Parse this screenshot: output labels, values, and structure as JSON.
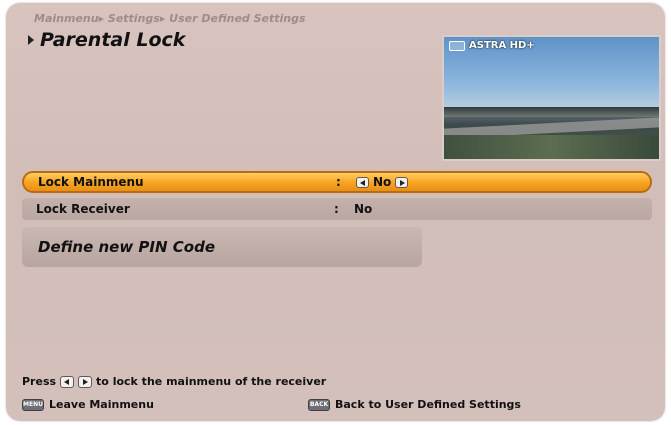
{
  "header": {
    "breadcrumb": "Mainmenu▸ Settings▸ User Defined Settings",
    "title": "Parental Lock"
  },
  "preview": {
    "channel": "ASTRA HD+",
    "channel_icon": "hd-icon"
  },
  "settings": [
    {
      "label": "Lock Mainmenu",
      "colon": ":",
      "value": "No",
      "selected": true
    },
    {
      "label": "Lock Receiver",
      "colon": ":",
      "value": "No",
      "selected": false
    }
  ],
  "pin_button": {
    "label": "Define new PIN Code"
  },
  "help": {
    "prefix": "Press",
    "suffix": "to lock the mainmenu of the receiver"
  },
  "footer": {
    "menu_key": "MENU",
    "menu_label": "Leave Mainmenu",
    "back_key": "BACK",
    "back_label": "Back to User Defined Settings"
  },
  "colors": {
    "selected_highlight": "#f7a624",
    "background": "#d2bdb8",
    "text": "#111111"
  }
}
